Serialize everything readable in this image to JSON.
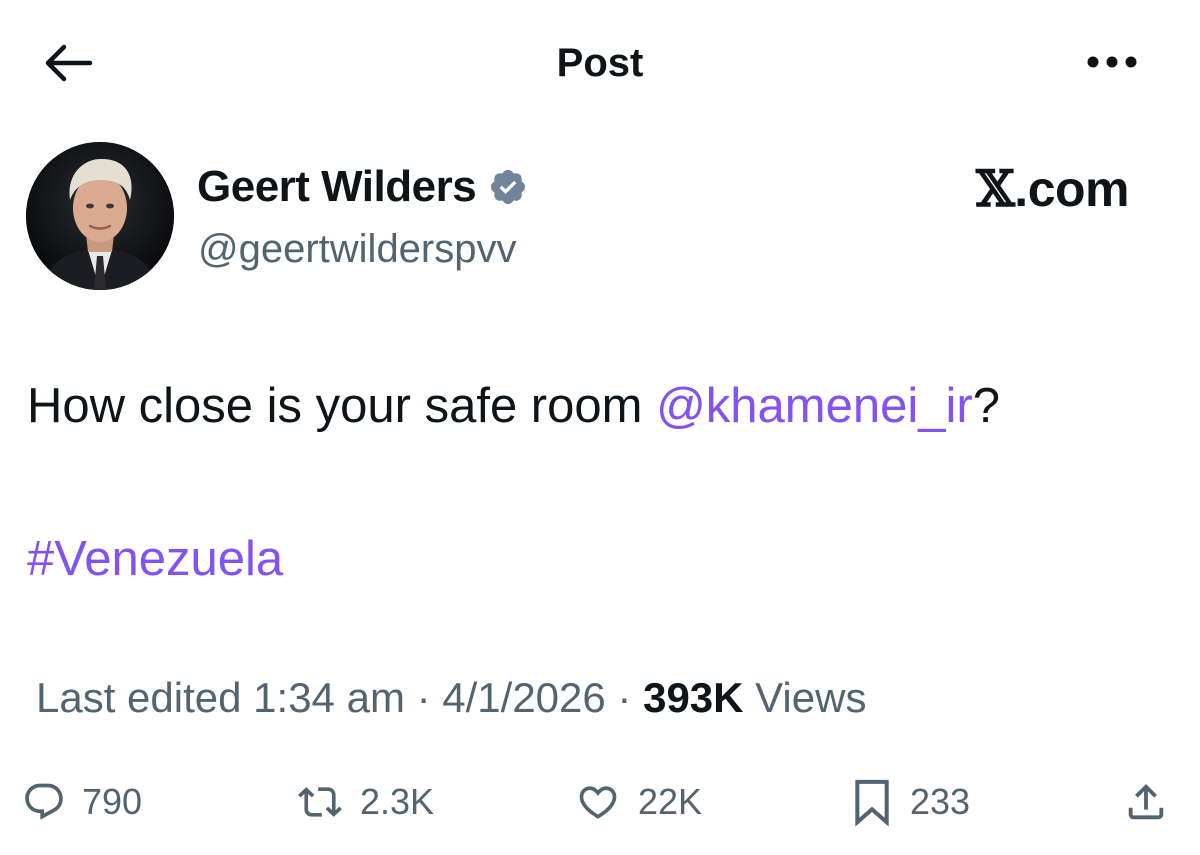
{
  "header": {
    "title": "Post"
  },
  "author": {
    "name": "Geert Wilders",
    "handle": "@geertwilderspvv",
    "verified": true
  },
  "brand": {
    "x_glyph": "𝕏",
    "suffix": ".com"
  },
  "post": {
    "text_before": "How close is your safe room ",
    "mention": "@khamenei_ir",
    "text_after": "?",
    "hashtag": "#Venezuela"
  },
  "meta": {
    "edited_label": "Last edited",
    "time": "1:34 am",
    "sep1": " · ",
    "date": "4/1/2026",
    "sep2": " · ",
    "views_count": "393K",
    "views_label": "Views"
  },
  "actions": {
    "replies": "790",
    "reposts": "2.3K",
    "likes": "22K",
    "bookmarks": "233"
  },
  "colors": {
    "link": "#8252f2",
    "secondary_text": "#536471",
    "verified_badge": "#71859a"
  },
  "icons": [
    "back-arrow-icon",
    "more-dots-icon",
    "verified-badge-icon",
    "reply-icon",
    "repost-icon",
    "like-icon",
    "bookmark-icon",
    "share-icon"
  ]
}
